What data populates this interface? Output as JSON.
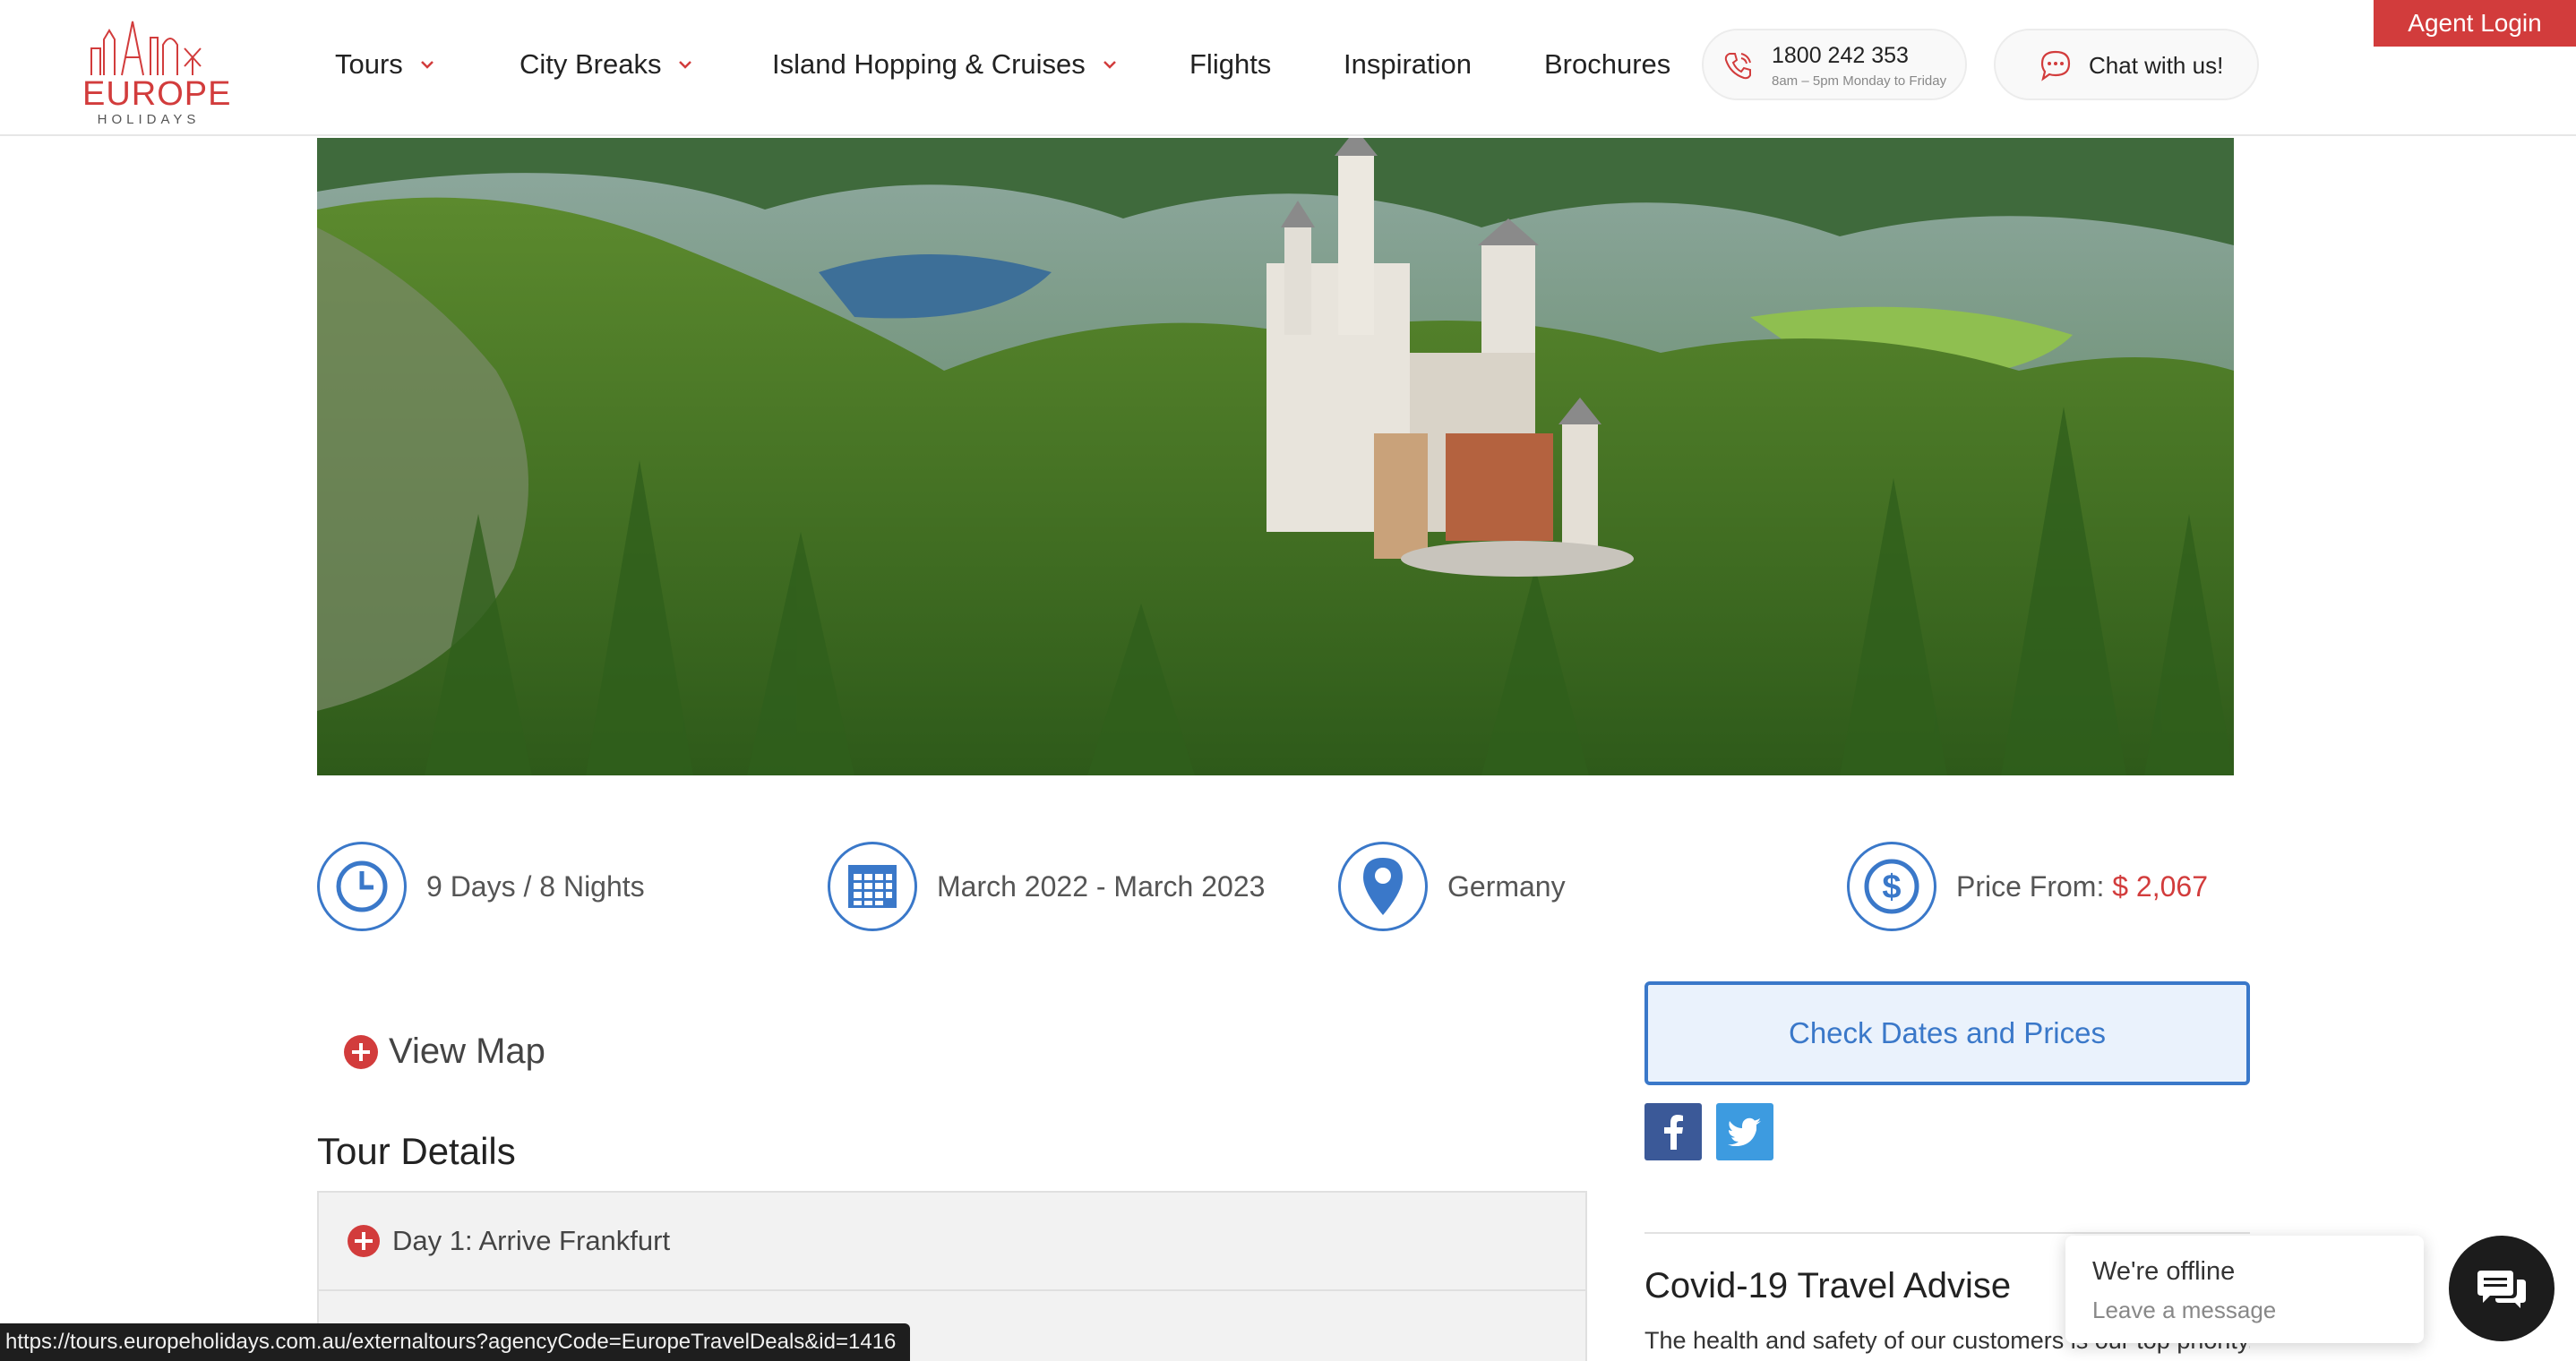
{
  "brand": {
    "logo_line1": "EUROPE",
    "logo_line2": "HOLIDAYS",
    "accent_color": "#d23c3c",
    "link_color": "#3a78c9"
  },
  "nav": {
    "items": [
      {
        "label": "Tours",
        "has_dropdown": true
      },
      {
        "label": "City Breaks",
        "has_dropdown": true
      },
      {
        "label": "Island Hopping & Cruises",
        "has_dropdown": true
      },
      {
        "label": "Flights",
        "has_dropdown": false
      },
      {
        "label": "Inspiration",
        "has_dropdown": false
      },
      {
        "label": "Brochures",
        "has_dropdown": false
      }
    ],
    "phone": {
      "number": "1800 242 353",
      "hours": "8am – 5pm Monday to Friday",
      "icon": "phone-icon"
    },
    "chat": {
      "label": "Chat with us!",
      "icon": "chat-bubble-icon"
    },
    "agent_login": "Agent Login"
  },
  "hero": {
    "icon": "castle-landscape-image"
  },
  "tour_info": {
    "duration": "9 Days / 8 Nights",
    "dates": "March 2022 - March 2023",
    "location": "Germany",
    "price_label": "Price From:",
    "price_value": "$ 2,067"
  },
  "main": {
    "view_map": "View Map",
    "tour_details_title": "Tour Details",
    "days": [
      {
        "label": "Day 1: Arrive Frankfurt"
      },
      {
        "label": ""
      }
    ]
  },
  "sidebar": {
    "check_button": "Check Dates and Prices",
    "social": [
      {
        "icon": "facebook-icon"
      },
      {
        "icon": "twitter-icon"
      }
    ],
    "covid_title": "Covid-19 Travel Advise",
    "covid_text": "The health and safety of our customers is our top priority."
  },
  "chat_widget": {
    "status": "We're offline",
    "prompt": "Leave a message"
  },
  "status_bar": {
    "url": "https://tours.europeholidays.com.au/externaltours?agencyCode=EuropeTravelDeals&id=1416"
  }
}
